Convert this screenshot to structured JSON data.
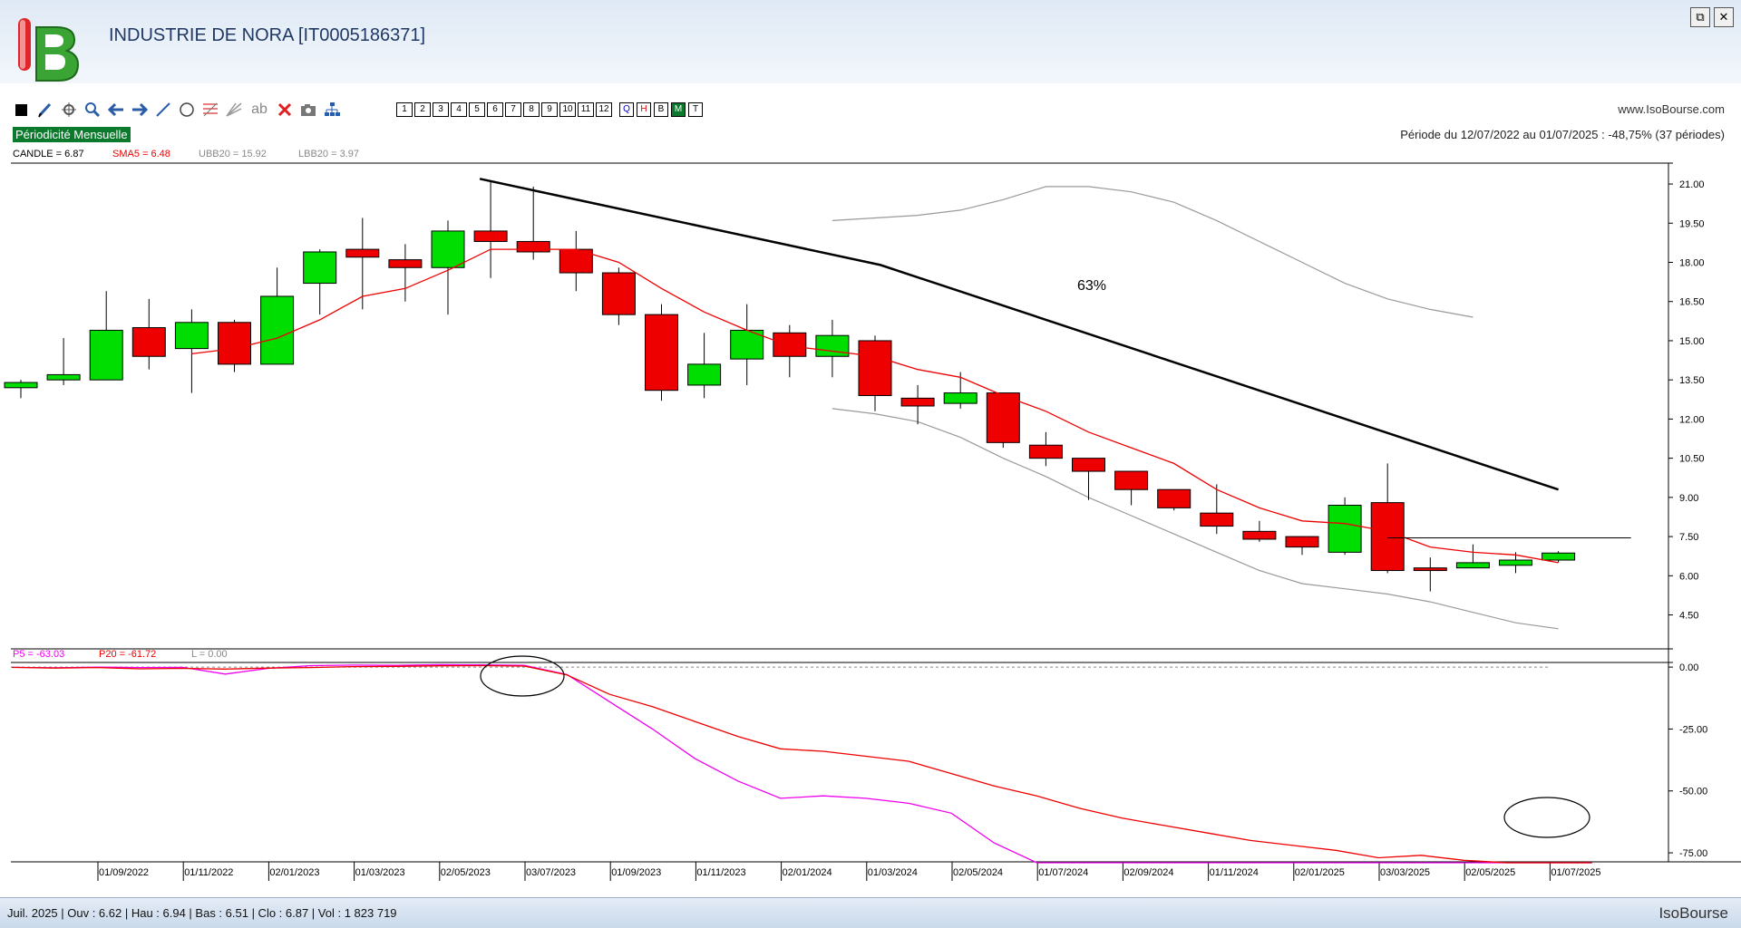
{
  "window": {
    "title": "INDUSTRIE DE NORA [IT0005186371]",
    "restore_glyph": "⧉",
    "close_glyph": "✕"
  },
  "toolbar": {
    "tools": [
      "square-icon",
      "pencil-icon",
      "crosshair-icon",
      "zoom-icon",
      "arrow-left-icon",
      "arrow-right-icon",
      "line-icon",
      "circle-icon",
      "fibonacci-icon",
      "fan-icon",
      "text-icon",
      "delete-icon",
      "camera-icon",
      "tree-icon"
    ],
    "text_tool_label": "ab",
    "period_buttons": [
      "1",
      "2",
      "3",
      "4",
      "5",
      "6",
      "7",
      "8",
      "9",
      "10",
      "11",
      "12"
    ],
    "view_buttons": [
      "Q",
      "H",
      "B",
      "M",
      "T"
    ],
    "active_view": "M"
  },
  "site": "www.IsoBourse.com",
  "periodicity": "Périodicité Mensuelle",
  "period_info": "Période du 12/07/2022 au 01/07/2025 : -48,75% (37 périodes)",
  "colors": {
    "up": "#00dd00",
    "down": "#ee0000",
    "sma": "#ee0000",
    "bollinger": "#999999",
    "p5": "#ee00ee",
    "p20": "#ee0000",
    "trend": "#000000"
  },
  "chart_data": [
    {
      "type": "candlestick",
      "legend": [
        {
          "label": "CANDLE = 6.87",
          "color": "#000000"
        },
        {
          "label": "SMA5 = 6.48",
          "color": "#ee0000"
        },
        {
          "label": "UBB20 = 15.92",
          "color": "#888888"
        },
        {
          "label": "LBB20 = 3.97",
          "color": "#888888"
        }
      ],
      "ylim": [
        3.2,
        21.8
      ],
      "y_ticks": [
        "21.00",
        "19.50",
        "18.00",
        "16.50",
        "15.00",
        "13.50",
        "12.00",
        "10.50",
        "9.00",
        "7.50",
        "6.00",
        "4.50"
      ],
      "x_ticks": [
        "01/09/2022",
        "01/11/2022",
        "02/01/2023",
        "01/03/2023",
        "02/05/2023",
        "03/07/2023",
        "01/09/2023",
        "01/11/2023",
        "02/01/2024",
        "01/03/2024",
        "02/05/2024",
        "01/07/2024",
        "02/09/2024",
        "01/11/2024",
        "02/01/2025",
        "03/03/2025",
        "02/05/2025",
        "01/07/2025"
      ],
      "candles": [
        {
          "o": 13.2,
          "h": 13.5,
          "l": 12.8,
          "c": 13.4
        },
        {
          "o": 13.5,
          "h": 15.1,
          "l": 13.3,
          "c": 13.7
        },
        {
          "o": 13.5,
          "h": 16.9,
          "l": 13.5,
          "c": 15.4
        },
        {
          "o": 15.5,
          "h": 16.6,
          "l": 13.9,
          "c": 14.4
        },
        {
          "o": 14.7,
          "h": 16.2,
          "l": 13.0,
          "c": 15.7
        },
        {
          "o": 15.7,
          "h": 15.8,
          "l": 13.8,
          "c": 14.1
        },
        {
          "o": 14.1,
          "h": 17.8,
          "l": 14.1,
          "c": 16.7
        },
        {
          "o": 17.2,
          "h": 18.5,
          "l": 16.0,
          "c": 18.4
        },
        {
          "o": 18.5,
          "h": 19.7,
          "l": 16.2,
          "c": 18.2
        },
        {
          "o": 18.1,
          "h": 18.7,
          "l": 16.5,
          "c": 17.8
        },
        {
          "o": 17.8,
          "h": 19.6,
          "l": 16.0,
          "c": 19.2
        },
        {
          "o": 19.2,
          "h": 21.1,
          "l": 17.4,
          "c": 18.8
        },
        {
          "o": 18.8,
          "h": 20.9,
          "l": 18.1,
          "c": 18.4
        },
        {
          "o": 18.5,
          "h": 19.2,
          "l": 16.9,
          "c": 17.6
        },
        {
          "o": 17.6,
          "h": 17.8,
          "l": 15.6,
          "c": 16.0
        },
        {
          "o": 16.0,
          "h": 16.4,
          "l": 12.7,
          "c": 13.1
        },
        {
          "o": 13.3,
          "h": 15.3,
          "l": 12.8,
          "c": 14.1
        },
        {
          "o": 14.3,
          "h": 16.4,
          "l": 13.3,
          "c": 15.4
        },
        {
          "o": 15.3,
          "h": 15.6,
          "l": 13.6,
          "c": 14.4
        },
        {
          "o": 14.4,
          "h": 15.8,
          "l": 13.6,
          "c": 15.2
        },
        {
          "o": 15.0,
          "h": 15.2,
          "l": 12.3,
          "c": 12.9
        },
        {
          "o": 12.8,
          "h": 13.3,
          "l": 11.8,
          "c": 12.5
        },
        {
          "o": 12.6,
          "h": 13.8,
          "l": 12.4,
          "c": 13.0
        },
        {
          "o": 13.0,
          "h": 13.0,
          "l": 10.9,
          "c": 11.1
        },
        {
          "o": 11.0,
          "h": 11.5,
          "l": 10.2,
          "c": 10.5
        },
        {
          "o": 10.5,
          "h": 10.5,
          "l": 8.9,
          "c": 10.0
        },
        {
          "o": 10.0,
          "h": 10.0,
          "l": 8.7,
          "c": 9.3
        },
        {
          "o": 9.3,
          "h": 9.3,
          "l": 8.5,
          "c": 8.6
        },
        {
          "o": 8.4,
          "h": 9.5,
          "l": 7.6,
          "c": 7.9
        },
        {
          "o": 7.7,
          "h": 8.1,
          "l": 7.3,
          "c": 7.4
        },
        {
          "o": 7.5,
          "h": 7.5,
          "l": 6.8,
          "c": 7.1
        },
        {
          "o": 6.9,
          "h": 9.0,
          "l": 6.8,
          "c": 8.7
        },
        {
          "o": 8.8,
          "h": 10.3,
          "l": 6.1,
          "c": 6.2
        },
        {
          "o": 6.3,
          "h": 6.7,
          "l": 5.4,
          "c": 6.2
        },
        {
          "o": 6.3,
          "h": 7.2,
          "l": 6.3,
          "c": 6.5
        },
        {
          "o": 6.4,
          "h": 6.9,
          "l": 6.1,
          "c": 6.6
        },
        {
          "o": 6.6,
          "h": 6.94,
          "l": 6.51,
          "c": 6.87
        }
      ],
      "sma5": [
        null,
        null,
        null,
        null,
        14.5,
        14.7,
        15.1,
        15.8,
        16.7,
        17.0,
        17.7,
        18.5,
        18.5,
        18.5,
        18.0,
        17.0,
        16.1,
        15.4,
        14.8,
        14.6,
        14.4,
        13.9,
        13.6,
        12.9,
        12.3,
        11.5,
        10.9,
        10.3,
        9.3,
        8.6,
        8.1,
        8.0,
        7.7,
        7.1,
        6.9,
        6.8,
        6.5
      ],
      "ubb20": [
        null,
        null,
        null,
        null,
        null,
        null,
        null,
        null,
        null,
        null,
        null,
        null,
        null,
        null,
        null,
        null,
        null,
        null,
        null,
        19.6,
        19.7,
        19.8,
        20.0,
        20.4,
        20.9,
        20.9,
        20.7,
        20.3,
        19.6,
        18.8,
        18.0,
        17.2,
        16.6,
        16.2,
        15.9
      ],
      "lbb20": [
        null,
        null,
        null,
        null,
        null,
        null,
        null,
        null,
        null,
        null,
        null,
        null,
        null,
        null,
        null,
        null,
        null,
        null,
        null,
        12.4,
        12.2,
        11.9,
        11.3,
        10.5,
        9.8,
        9.0,
        8.3,
        7.6,
        6.9,
        6.2,
        5.7,
        5.5,
        5.3,
        5.0,
        4.6,
        4.2,
        3.97
      ],
      "annotation": "63%",
      "trendline": {
        "from": {
          "i": 11,
          "y": 21.2
        },
        "to": {
          "i": 36,
          "y": 9.3
        },
        "via": {
          "i": 20,
          "y": 17.9
        }
      },
      "level_line": {
        "y": 7.45,
        "from_i": 32,
        "to_i": 37.7
      }
    },
    {
      "type": "line",
      "legend": [
        {
          "label": "P5 = -63.03",
          "color": "#ee00ee"
        },
        {
          "label": "P20 = -61.72",
          "color": "#ee0000"
        },
        {
          "label": "L = 0.00",
          "color": "#888888"
        }
      ],
      "ylim": [
        -79,
        1.5
      ],
      "y_ticks": [
        "0.00",
        "-25.00",
        "-50.00",
        "-75.00"
      ],
      "reference_line": 0,
      "series": [
        {
          "name": "P5",
          "color": "#ee00ee",
          "values": [
            -0.1,
            -0.3,
            0,
            -0.2,
            -0.1,
            -2.8,
            -0.5,
            0.6,
            0.8,
            0.7,
            1,
            0.9,
            0.7,
            -3,
            -14,
            -25,
            -37,
            -46,
            -53,
            -52,
            -53,
            -55,
            -59,
            -71,
            -79,
            -80,
            -79,
            -81,
            -85,
            -89,
            -94,
            -98,
            -99,
            -101,
            -96,
            -98,
            -90,
            -80
          ]
        },
        {
          "name": "P20",
          "color": "#ee0000",
          "values": [
            -0.1,
            -0.4,
            -0.2,
            -0.7,
            -0.5,
            -0.8,
            -0.4,
            -0.2,
            0.2,
            0.3,
            0.5,
            0.6,
            0.4,
            -3.2,
            -11,
            -16,
            -22,
            -28,
            -33,
            -34,
            -36,
            -38,
            -43,
            -48,
            -52,
            -57,
            -61,
            -64,
            -67,
            -70,
            -72,
            -74,
            -77,
            -76,
            -78,
            -80,
            -80,
            -79
          ]
        }
      ],
      "series_note_p20_p5_display": "scaled to axis"
    }
  ],
  "status": "Juil. 2025 | Ouv : 6.62 | Hau : 6.94 | Bas : 6.51 | Clo : 6.87 | Vol : 1 823 719",
  "brand": "IsoBourse"
}
